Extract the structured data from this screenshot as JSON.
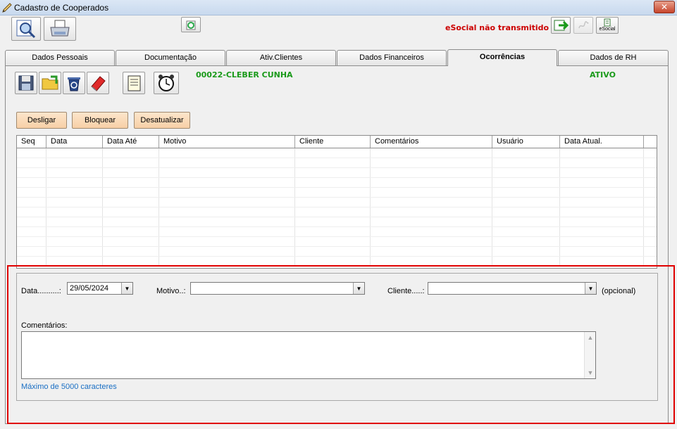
{
  "window": {
    "title": "Cadastro de Cooperados",
    "close_label": "✕"
  },
  "esocial": {
    "status_text": "eSocial não transmitido",
    "badge_label": "eSocial"
  },
  "tabs": [
    {
      "label": "Dados Pessoais"
    },
    {
      "label": "Documentação"
    },
    {
      "label": "Ativ.Clientes"
    },
    {
      "label": "Dados Financeiros"
    },
    {
      "label": "Ocorrências"
    },
    {
      "label": "Dados de RH"
    }
  ],
  "cooperado": {
    "name": "00022-CLEBER CUNHA",
    "status": "ATIVO"
  },
  "actions": {
    "desligar": "Desligar",
    "bloquear": "Bloquear",
    "desatualizar": "Desatualizar"
  },
  "grid": {
    "columns": [
      "Seq",
      "Data",
      "Data Até",
      "Motivo",
      "Cliente",
      "Comentários",
      "Usuário",
      "Data Atual."
    ]
  },
  "form": {
    "data_label": "Data..........:",
    "data_value": "29/05/2024",
    "motivo_label": "Motivo..:",
    "motivo_value": "",
    "cliente_label": "Cliente.....:",
    "cliente_value": "",
    "opcional_label": "(opcional)",
    "comentarios_label": "Comentários:",
    "comentarios_value": "",
    "max_chars_label": "Máximo de 5000 caracteres"
  },
  "colors": {
    "accent_green": "#1a9a1a",
    "alert_red": "#cc0000",
    "highlight_red": "#e00000",
    "action_button": "#f7cfa6",
    "link_blue": "#1a6fc4"
  },
  "icons": {
    "title": "pen-icon",
    "search": "search-icon",
    "print": "printer-icon",
    "recycle": "recycle-icon",
    "export": "export-icon",
    "sign": "signature-icon",
    "save": "floppy-save-icon",
    "folder": "folder-icon",
    "trash": "trash-icon",
    "eraser": "eraser-icon",
    "notes": "notepad-icon",
    "clock": "alarm-clock-icon"
  }
}
